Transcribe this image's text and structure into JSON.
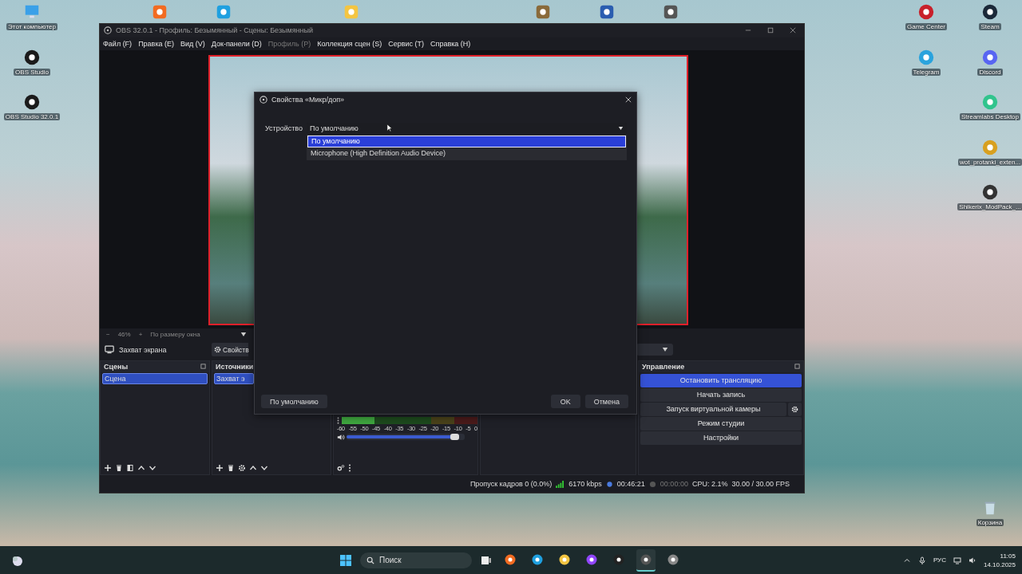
{
  "desktop_icons": [
    {
      "label": "Этот компьютер"
    },
    {
      "label": "OBS Studio"
    },
    {
      "label": "OBS Studio 32.0.1"
    },
    {
      "label": "Game Center"
    },
    {
      "label": "Steam"
    },
    {
      "label": "Telegram"
    },
    {
      "label": "Discord"
    },
    {
      "label": "Streamlabs Desktop"
    },
    {
      "label": "wot_protanki_exten..."
    },
    {
      "label": "Shikerix_ModPack_..."
    },
    {
      "label": "Корзина"
    }
  ],
  "obs_window": {
    "title": "OBS 32.0.1 - Профиль: Безымянный - Сцены: Безымянный",
    "menu": [
      {
        "label": "Файл (F)",
        "disabled": false
      },
      {
        "label": "Правка (E)",
        "disabled": false
      },
      {
        "label": "Вид (V)",
        "disabled": false
      },
      {
        "label": "Док-панели (D)",
        "disabled": false
      },
      {
        "label": "Профиль (P)",
        "disabled": true
      },
      {
        "label": "Коллекция сцен (S)",
        "disabled": false
      },
      {
        "label": "Сервис (T)",
        "disabled": false
      },
      {
        "label": "Справка (H)",
        "disabled": false
      }
    ],
    "zoom_bar": {
      "zoom_out": "−",
      "zoom": "46%",
      "zoom_in": "+",
      "fit": "По размеру окна"
    },
    "source_bar": {
      "source": "Захват экрана",
      "properties": "Свойств"
    },
    "scenes": {
      "title": "Сцены",
      "items": [
        {
          "label": "Сцена",
          "selected": true
        }
      ]
    },
    "sources": {
      "title": "Источники",
      "items": [
        {
          "label": "Захват э",
          "selected": true
        }
      ]
    },
    "mixer": {
      "meter": {
        "level": 0.24
      },
      "scale": [
        "-60",
        "-55",
        "-50",
        "-45",
        "-40",
        "-35",
        "-30",
        "-25",
        "-20",
        "-15",
        "-10",
        "-5",
        "0"
      ],
      "volume": {
        "level": 0.95
      }
    },
    "controls": {
      "title": "Управление",
      "buttons": [
        {
          "label": "Остановить трансляцию",
          "on": true,
          "kind": "plain"
        },
        {
          "label": "Начать запись",
          "on": false,
          "kind": "plain"
        },
        {
          "label": "Запуск виртуальной камеры",
          "on": false,
          "kind": "with_settings"
        },
        {
          "label": "Режим студии",
          "on": false,
          "kind": "plain"
        },
        {
          "label": "Настройки",
          "on": false,
          "kind": "plain"
        }
      ]
    },
    "status_bar": {
      "dropped": "Пропуск кадров 0 (0.0%)",
      "bitrate": "6170 kbps",
      "stream_time": "00:46:21",
      "record_time": "00:00:00",
      "cpu": "CPU: 2.1%",
      "fps": "30.00 / 30.00 FPS"
    }
  },
  "dialog": {
    "title": "Свойства «Микр/доп»",
    "device_label": "Устройство",
    "device_value": "По умолчанию",
    "options": [
      {
        "label": "По умолчанию",
        "selected": true
      },
      {
        "label": "Microphone (High Definition Audio Device)",
        "selected": false
      }
    ],
    "defaults_button": "По умолчанию",
    "ok_button": "OK",
    "cancel_button": "Отмена"
  },
  "taskbar": {
    "search_placeholder": "Поиск",
    "apps": [
      {
        "active": false
      },
      {
        "active": false
      },
      {
        "active": false
      },
      {
        "active": false
      },
      {
        "active": false
      },
      {
        "active": true
      },
      {
        "active": false
      }
    ],
    "language": "РУС",
    "time": "11:05",
    "date": "14.10.2025"
  }
}
